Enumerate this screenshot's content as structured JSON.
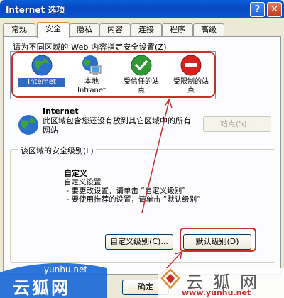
{
  "window": {
    "title": "Internet 选项",
    "help_glyph": "?",
    "close_glyph": "✕"
  },
  "tabs": [
    {
      "label": "常规"
    },
    {
      "label": "安全",
      "active": true
    },
    {
      "label": "隐私"
    },
    {
      "label": "内容"
    },
    {
      "label": "连接"
    },
    {
      "label": "程序"
    },
    {
      "label": "高级"
    }
  ],
  "zones": {
    "prompt": "请为不同区域的 Web 内容指定安全设置(Z)",
    "items": [
      {
        "label": "Internet",
        "icon": "globe-icon",
        "selected": true
      },
      {
        "label": "本地\nIntranet",
        "icon": "intranet-computer-icon"
      },
      {
        "label": "受信任的站\n点",
        "icon": "trusted-check-icon"
      },
      {
        "label": "受限制的站\n点",
        "icon": "restricted-stop-icon"
      }
    ]
  },
  "zone_info": {
    "name": "Internet",
    "description": "此区域包含您还没有放到其它区域中的所有网站",
    "sites_button": "站点(S)..."
  },
  "security_level": {
    "group_label": "该区域的安全级别(L)",
    "title": "自定义",
    "body": "自定义设置\n - 要更改设置，请单击 “自定义级别”\n - 要使用推荐的设置，请单击 “默认级别”",
    "custom_button": "自定义级别(C)...",
    "default_button": "默认级别(D)"
  },
  "footer": {
    "ok_button": "确定"
  },
  "watermark": {
    "left_url": "yunhu.net",
    "left_name": "云狐网",
    "right_name": "云狐网",
    "right_url": "www.yunhu.net"
  },
  "colors": {
    "highlight": "#c8302c",
    "titlebar": "#0848c0",
    "tab_accent": "#e68b2c"
  }
}
